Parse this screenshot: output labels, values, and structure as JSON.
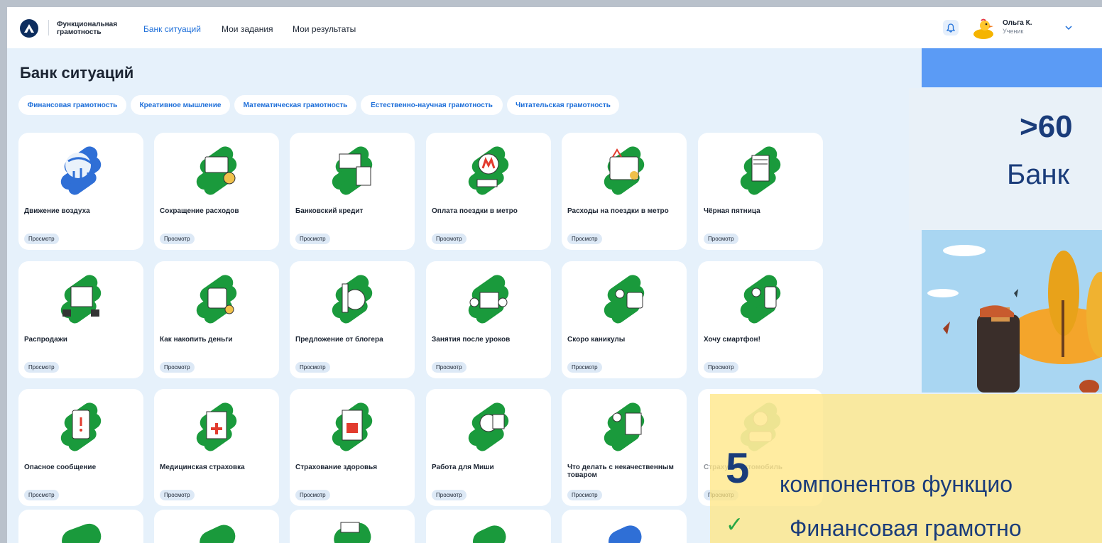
{
  "header": {
    "brand_line1": "Функциональная",
    "brand_line2": "грамотность",
    "nav": [
      "Банк ситуаций",
      "Мои задания",
      "Мои результаты"
    ],
    "user_name": "Ольга К.",
    "user_role": "Ученик"
  },
  "page": {
    "title": "Банк ситуаций",
    "filters": [
      "Финансовая грамотность",
      "Креативное мышление",
      "Математическая грамотность",
      "Естественно-научная грамотность",
      "Читательская грамотность"
    ]
  },
  "cards": [
    {
      "title": "Движение воздуха",
      "badge": "Просмотр"
    },
    {
      "title": "Сокращение расходов",
      "badge": "Просмотр"
    },
    {
      "title": "Банковский кредит",
      "badge": "Просмотр"
    },
    {
      "title": "Оплата поездки в метро",
      "badge": "Просмотр"
    },
    {
      "title": "Расходы на поездки в метро",
      "badge": "Просмотр"
    },
    {
      "title": "Чёрная пятница",
      "badge": "Просмотр"
    },
    {
      "title": "Распродажи",
      "badge": "Просмотр"
    },
    {
      "title": "Как накопить деньги",
      "badge": "Просмотр"
    },
    {
      "title": "Предложение от блогера",
      "badge": "Просмотр"
    },
    {
      "title": "Занятия после уроков",
      "badge": "Просмотр"
    },
    {
      "title": "Скоро каникулы",
      "badge": "Просмотр"
    },
    {
      "title": "Хочу смартфон!",
      "badge": "Просмотр"
    },
    {
      "title": "Опасное сообщение",
      "badge": "Просмотр"
    },
    {
      "title": "Медицинская страховка",
      "badge": "Просмотр"
    },
    {
      "title": "Страхование здоровья",
      "badge": "Просмотр"
    },
    {
      "title": "Работа для Миши",
      "badge": "Просмотр"
    },
    {
      "title": "Что делать с некачественным товаром",
      "badge": "Просмотр"
    },
    {
      "title": "Страхуем автомобиль",
      "badge": "Просмотр"
    }
  ],
  "overlay": {
    "stat": ">60",
    "stat_label": "Банк",
    "big_number": "5",
    "components_text": "компонентов функцио",
    "first_item": "Финансовая грамотно"
  },
  "colors": {
    "accent": "#1e6fd9",
    "card_icon_green": "#1a9a3c",
    "background": "#e6f1fb",
    "navy": "#1a3c7a"
  }
}
